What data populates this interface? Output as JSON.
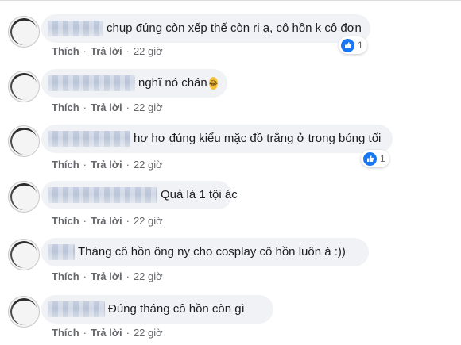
{
  "comments": [
    {
      "text": "chụp đúng còn xếp thế còn ri ạ, cô hồn k cô đơn",
      "actions": {
        "like": "Thích",
        "reply": "Trả lời",
        "time": "22 giờ"
      },
      "reaction_count": "1",
      "emoji": null
    },
    {
      "text": "nghĩ nó chán",
      "actions": {
        "like": "Thích",
        "reply": "Trả lời",
        "time": "22 giờ"
      },
      "reaction_count": null,
      "emoji": "laughing-crying-emoji"
    },
    {
      "text": "hơ hơ đúng kiểu mặc đồ trắng ở trong bóng tối",
      "actions": {
        "like": "Thích",
        "reply": "Trả lời",
        "time": "22 giờ"
      },
      "reaction_count": "1",
      "emoji": null
    },
    {
      "text": "Quả là 1 tội ác",
      "actions": {
        "like": "Thích",
        "reply": "Trả lời",
        "time": "22 giờ"
      },
      "reaction_count": null,
      "emoji": null
    },
    {
      "text": "Tháng cô hồn ông ny cho cosplay cô hồn luôn à :))",
      "actions": {
        "like": "Thích",
        "reply": "Trả lời",
        "time": "22 giờ"
      },
      "reaction_count": null,
      "emoji": null
    },
    {
      "text": "Đúng tháng cô hồn còn gì",
      "actions": {
        "like": "Thích",
        "reply": "Trả lời",
        "time": "22 giờ"
      },
      "reaction_count": null,
      "emoji": null
    }
  ],
  "colors": {
    "bubble": "#f0f2f5",
    "like_blue": "#1877f2",
    "meta_text": "#65676b"
  }
}
